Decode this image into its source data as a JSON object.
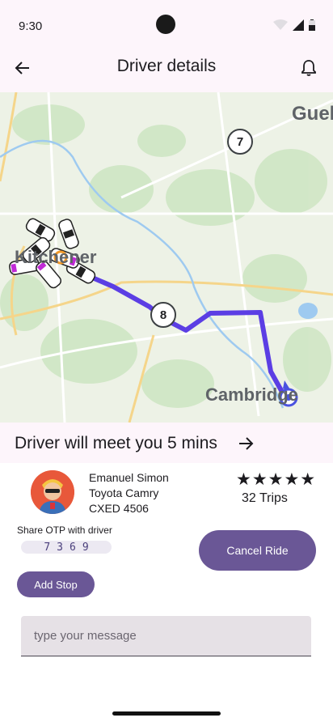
{
  "status_bar": {
    "time": "9:30"
  },
  "app_bar": {
    "title": "Driver details"
  },
  "map": {
    "labels": {
      "city_north": "Guel",
      "city_west": "Kitchener",
      "city_east": "Cambridge"
    },
    "route_badges": [
      "7",
      "8"
    ],
    "route_color": "#5b3ee4"
  },
  "banner": {
    "text": "Driver will meet you 5 mins"
  },
  "driver": {
    "name": "Emanuel Simon",
    "car": "Toyota Camry",
    "plate": "CXED 4506",
    "rating_stars": "★★★★★",
    "rating": 5,
    "trips": "32 Trips"
  },
  "otp": {
    "label": "Share OTP with driver",
    "code": "7369"
  },
  "actions": {
    "cancel_label": "Cancel Ride",
    "add_stop_label": "Add Stop"
  },
  "message": {
    "placeholder": "type your message",
    "value": ""
  },
  "colors": {
    "accent": "#6a5796",
    "header_bg": "#fdf5fb"
  }
}
